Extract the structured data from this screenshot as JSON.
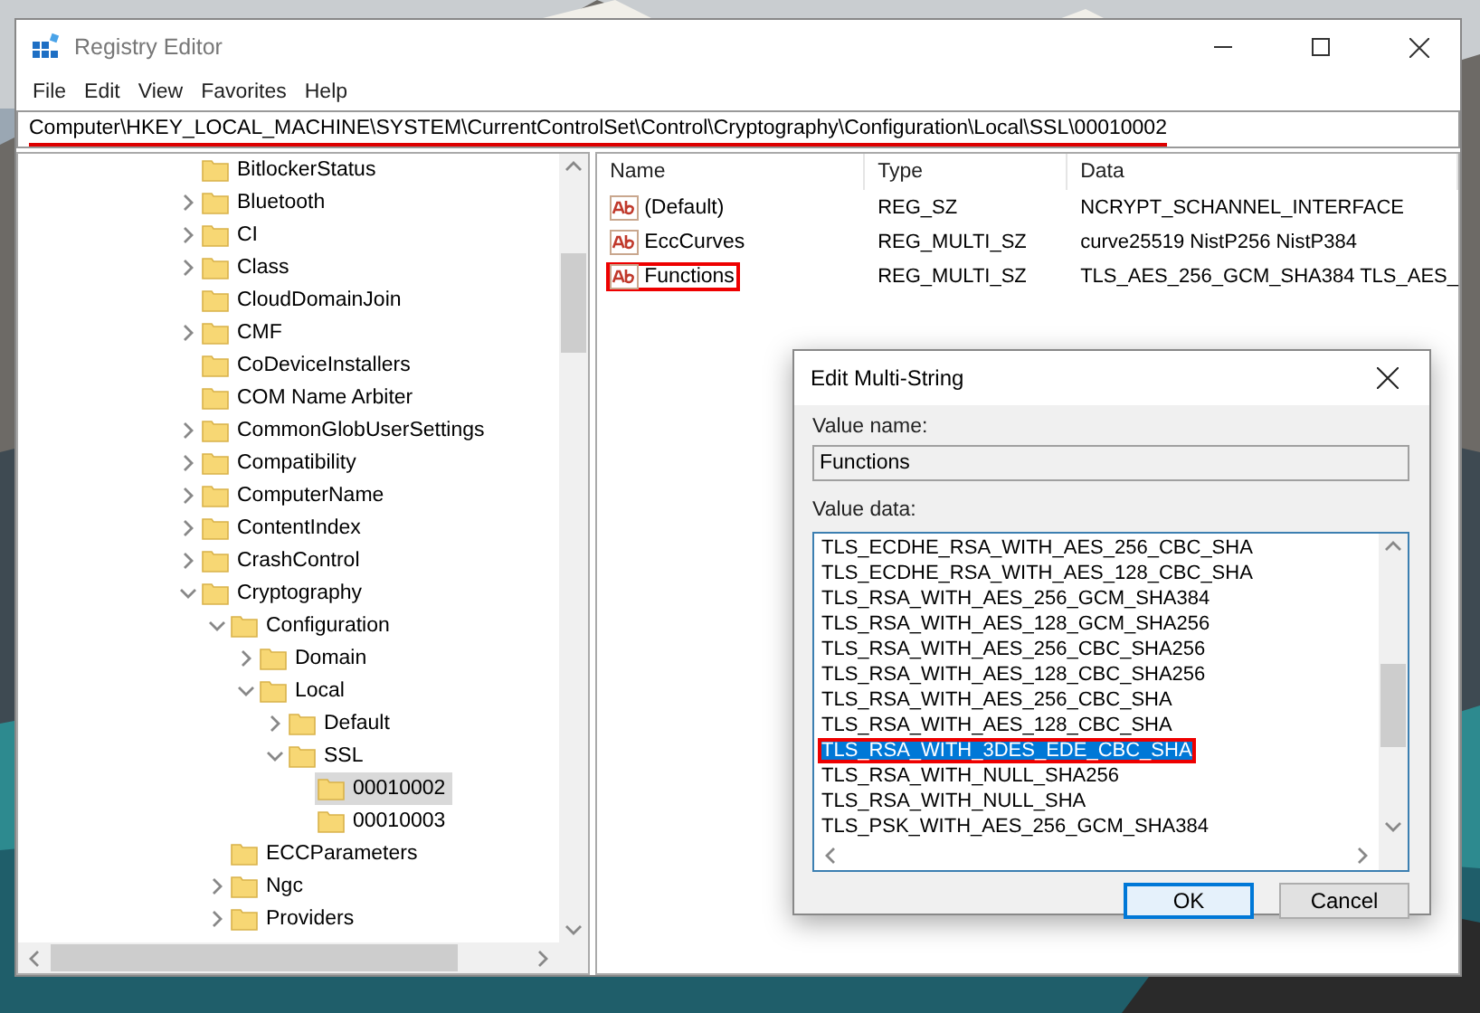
{
  "window": {
    "title": "Registry Editor"
  },
  "menu": [
    "File",
    "Edit",
    "View",
    "Favorites",
    "Help"
  ],
  "address": {
    "path": "Computer\\HKEY_LOCAL_MACHINE\\SYSTEM\\CurrentControlSet\\Control\\Cryptography\\Configuration\\Local\\SSL\\00010002",
    "annotated": true
  },
  "tree": [
    {
      "label": "BitlockerStatus",
      "expandable": false,
      "selected": false
    },
    {
      "label": "Bluetooth",
      "expandable": true,
      "expanded": false,
      "selected": false
    },
    {
      "label": "CI",
      "expandable": true,
      "expanded": false,
      "selected": false
    },
    {
      "label": "Class",
      "expandable": true,
      "expanded": false,
      "selected": false
    },
    {
      "label": "CloudDomainJoin",
      "expandable": false,
      "selected": false
    },
    {
      "label": "CMF",
      "expandable": true,
      "expanded": false,
      "selected": false
    },
    {
      "label": "CoDeviceInstallers",
      "expandable": false,
      "selected": false
    },
    {
      "label": "COM Name Arbiter",
      "expandable": false,
      "selected": false
    },
    {
      "label": "CommonGlobUserSettings",
      "expandable": true,
      "expanded": false,
      "selected": false
    },
    {
      "label": "Compatibility",
      "expandable": true,
      "expanded": false,
      "selected": false
    },
    {
      "label": "ComputerName",
      "expandable": true,
      "expanded": false,
      "selected": false
    },
    {
      "label": "ContentIndex",
      "expandable": true,
      "expanded": false,
      "selected": false
    },
    {
      "label": "CrashControl",
      "expandable": true,
      "expanded": false,
      "selected": false
    },
    {
      "label": "Cryptography",
      "expandable": true,
      "expanded": true,
      "selected": false,
      "children": [
        {
          "label": "Configuration",
          "expandable": true,
          "expanded": true,
          "selected": false,
          "children": [
            {
              "label": "Domain",
              "expandable": true,
              "expanded": false,
              "selected": false
            },
            {
              "label": "Local",
              "expandable": true,
              "expanded": true,
              "selected": false,
              "children": [
                {
                  "label": "Default",
                  "expandable": true,
                  "expanded": false,
                  "selected": false
                },
                {
                  "label": "SSL",
                  "expandable": true,
                  "expanded": true,
                  "selected": false,
                  "children": [
                    {
                      "label": "00010002",
                      "expandable": false,
                      "selected": true
                    },
                    {
                      "label": "00010003",
                      "expandable": false,
                      "selected": false
                    }
                  ]
                }
              ]
            }
          ]
        },
        {
          "label": "ECCParameters",
          "expandable": false,
          "selected": false
        },
        {
          "label": "Ngc",
          "expandable": true,
          "expanded": false,
          "selected": false
        },
        {
          "label": "Providers",
          "expandable": true,
          "expanded": false,
          "selected": false
        }
      ]
    }
  ],
  "values": {
    "columns": [
      "Name",
      "Type",
      "Data"
    ],
    "rows": [
      {
        "name": "(Default)",
        "type": "REG_SZ",
        "data": "NCRYPT_SCHANNEL_INTERFACE",
        "annotated": false
      },
      {
        "name": "EccCurves",
        "type": "REG_MULTI_SZ",
        "data": "curve25519 NistP256 NistP384",
        "annotated": false
      },
      {
        "name": "Functions",
        "type": "REG_MULTI_SZ",
        "data": "TLS_AES_256_GCM_SHA384 TLS_AES_",
        "annotated": true
      }
    ]
  },
  "dialog": {
    "title": "Edit Multi-String",
    "value_name_label": "Value name:",
    "value_name": "Functions",
    "value_data_label": "Value data:",
    "lines": [
      {
        "text": "TLS_ECDHE_RSA_WITH_AES_256_CBC_SHA",
        "selected": false
      },
      {
        "text": "TLS_ECDHE_RSA_WITH_AES_128_CBC_SHA",
        "selected": false
      },
      {
        "text": "TLS_RSA_WITH_AES_256_GCM_SHA384",
        "selected": false
      },
      {
        "text": "TLS_RSA_WITH_AES_128_GCM_SHA256",
        "selected": false
      },
      {
        "text": "TLS_RSA_WITH_AES_256_CBC_SHA256",
        "selected": false
      },
      {
        "text": "TLS_RSA_WITH_AES_128_CBC_SHA256",
        "selected": false
      },
      {
        "text": "TLS_RSA_WITH_AES_256_CBC_SHA",
        "selected": false
      },
      {
        "text": "TLS_RSA_WITH_AES_128_CBC_SHA",
        "selected": false
      },
      {
        "text": "TLS_RSA_WITH_3DES_EDE_CBC_SHA",
        "selected": true
      },
      {
        "text": "TLS_RSA_WITH_NULL_SHA256",
        "selected": false
      },
      {
        "text": "TLS_RSA_WITH_NULL_SHA",
        "selected": false
      },
      {
        "text": "TLS_PSK_WITH_AES_256_GCM_SHA384",
        "selected": false
      }
    ],
    "buttons": [
      "OK",
      "Cancel"
    ]
  }
}
